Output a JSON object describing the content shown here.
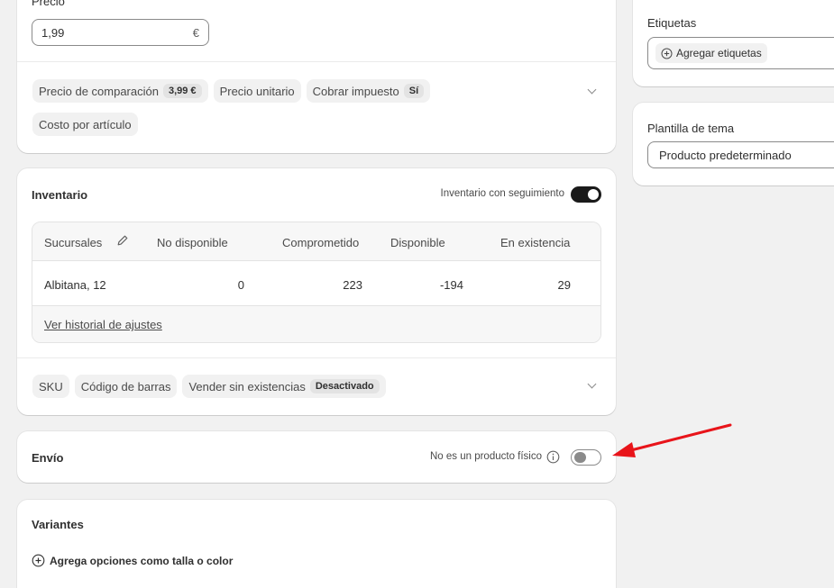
{
  "price": {
    "label": "Precio",
    "value": "1,99",
    "currency": "€",
    "pills": [
      {
        "label": "Precio de comparación",
        "tag": "3,99 €"
      },
      {
        "label": "Precio unitario"
      },
      {
        "label": "Cobrar impuesto",
        "tag": "Sí"
      },
      {
        "label": "Costo por artículo"
      }
    ]
  },
  "inventory": {
    "title": "Inventario",
    "tracking_label": "Inventario con seguimiento",
    "tracking_on": true,
    "columns": [
      "Sucursales",
      "No disponible",
      "Comprometido",
      "Disponible",
      "En existencia"
    ],
    "rows": [
      {
        "location": "Albitana, 12",
        "unavailable": "0",
        "committed": "223",
        "available": "-194",
        "on_hand": "29"
      }
    ],
    "history_link": "Ver historial de ajustes",
    "pills": [
      {
        "label": "SKU"
      },
      {
        "label": "Código de barras"
      },
      {
        "label": "Vender sin existencias",
        "tag": "Desactivado"
      }
    ]
  },
  "shipping": {
    "title": "Envío",
    "non_physical_label": "No es un producto físico",
    "non_physical_on": false
  },
  "variants": {
    "title": "Variantes",
    "add_label": "Agrega opciones como talla o color"
  },
  "sidebar": {
    "tags_label": "Etiquetas",
    "tags_button": "Agregar etiquetas",
    "template_label": "Plantilla de tema",
    "template_value": "Producto predeterminado"
  },
  "colors": {
    "annotation_arrow": "#e8141a",
    "toggle_on": "#1a1a1a"
  }
}
